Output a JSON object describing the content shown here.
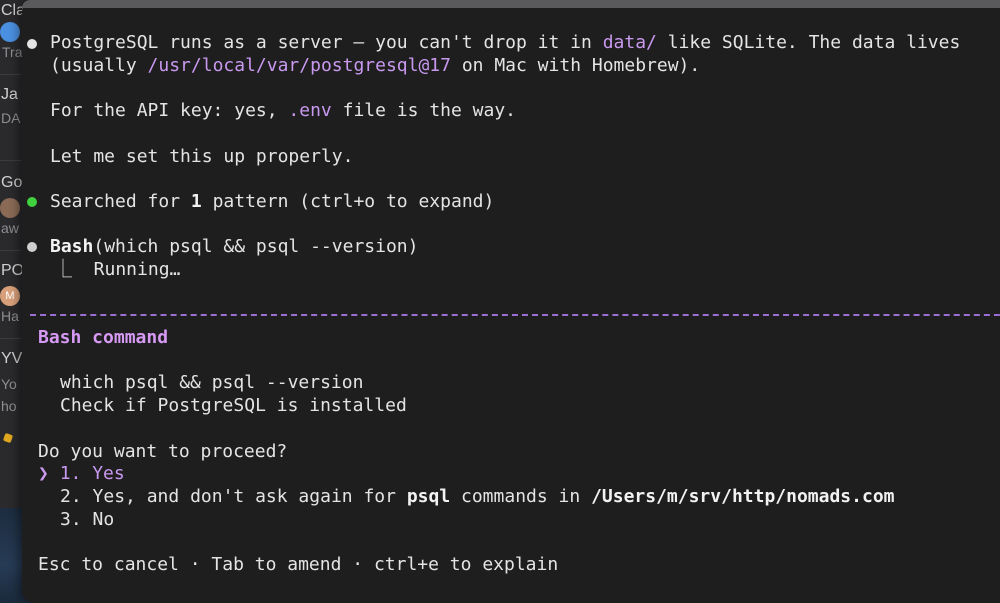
{
  "background_sidebar": {
    "items": [
      {
        "title": "Cla",
        "subtitle": "Tra"
      },
      {
        "title": "Ja",
        "subtitle": "DA"
      },
      {
        "title": "Go",
        "subtitle": "aw"
      },
      {
        "title": "PO",
        "avatar_letter": "M",
        "subtitle": "Ha"
      },
      {
        "title": "YV",
        "subtitle": "Yo",
        "subtitle2": "ho"
      }
    ]
  },
  "terminal": {
    "messages": {
      "intro_line1_a": "PostgreSQL runs as a server — you can't drop it in ",
      "intro_path1": "data/",
      "intro_line1_b": " like SQLite. The data lives",
      "intro_line2_a": "(usually ",
      "intro_path2": "/usr/local/var/postgresql@17",
      "intro_line2_b": " on Mac with Homebrew).",
      "api_line_a": "For the API key: yes, ",
      "api_file": ".env",
      "api_line_b": " file is the way.",
      "setup_line": "Let me set this up properly.",
      "search_a": "Searched for ",
      "search_count": "1",
      "search_b": " pattern (ctrl+o to expand)",
      "bash_tool": "Bash",
      "bash_args": "(which psql && psql --version)",
      "running": "⎿  Running…"
    },
    "colors": {
      "bullet_white": "#e4e4e4",
      "bullet_green": "#3fd13f",
      "bullet_gray": "#cfcfcf",
      "accent_purple": "#c999f0"
    },
    "prompt": {
      "title": "Bash command",
      "command": "which psql && psql --version",
      "description": "Check if PostgreSQL is installed",
      "question": "Do you want to proceed?",
      "cursor": "❯",
      "option1_num": "1.",
      "option1_label": "Yes",
      "option2_num": "2.",
      "option2_a": "Yes, and don't ask again for ",
      "option2_bold1": "psql",
      "option2_b": " commands in ",
      "option2_bold2": "/Users/m/srv/http/nomads.com",
      "option3_num": "3.",
      "option3_label": "No",
      "footer": "Esc to cancel · Tab to amend · ctrl+e to explain"
    }
  }
}
